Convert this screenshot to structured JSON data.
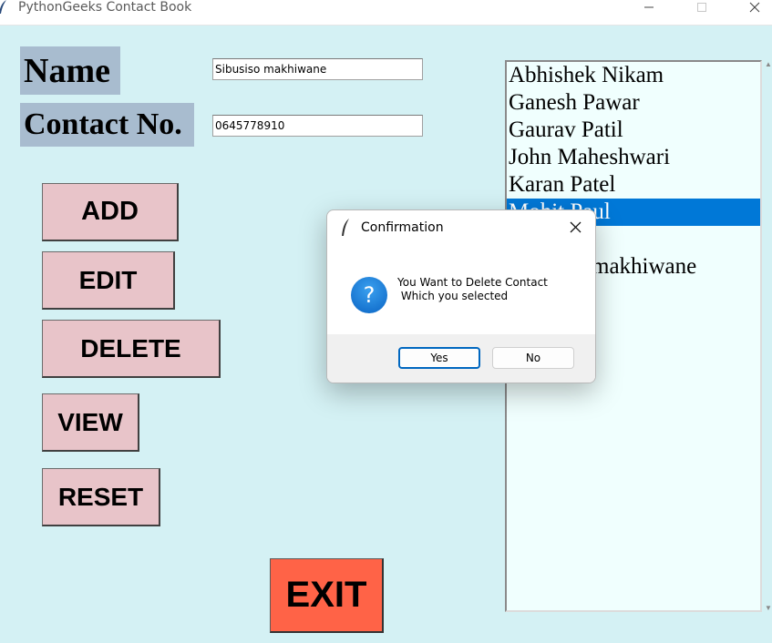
{
  "window": {
    "title": "PythonGeeks Contact Book",
    "minimize_glyph": "—",
    "maximize_glyph": "☐",
    "close_glyph": "✕"
  },
  "form": {
    "name_label": "Name",
    "contact_label": "Contact No.",
    "name_value": "Sibusiso makhiwane",
    "contact_value": "0645778910"
  },
  "buttons": {
    "add": "ADD",
    "edit": "EDIT",
    "delete": "DELETE",
    "view": "VIEW",
    "reset": "RESET",
    "exit": "EXIT"
  },
  "contacts": {
    "items": [
      "Abhishek Nikam",
      "Ganesh Pawar",
      "Gaurav Patil",
      "John Maheshwari",
      "Karan Patel",
      "Mohit Paul",
      "",
      "Sibusiso makhiwane"
    ],
    "selected_index": 5
  },
  "dialog": {
    "title": "Confirmation",
    "message_line1": "You Want to Delete Contact",
    "message_line2": " Which you selected",
    "yes": "Yes",
    "no": "No",
    "icon": "question-icon"
  },
  "colors": {
    "background": "#d4f1f4",
    "label_bg": "#a8bccf",
    "button_bg": "#e8c4c9",
    "exit_bg": "#ff6347",
    "selection": "#0078d7",
    "listbox_bg": "#f0fffe"
  }
}
